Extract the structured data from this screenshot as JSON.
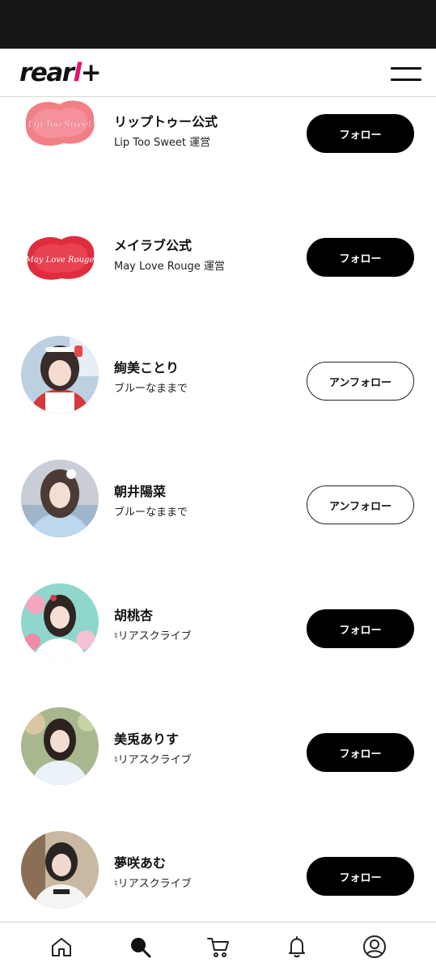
{
  "header": {
    "logo_main": "rear",
    "logo_accent": "l",
    "logo_plus": "+",
    "menu_icon": "hamburger-menu-icon"
  },
  "list": {
    "items": [
      {
        "name": "リップトゥー公式",
        "sub": "Lip Too Sweet 運営",
        "avatar_type": "logo",
        "logo_text": "Lip Too Sweet",
        "button": "フォロー",
        "following": false
      },
      {
        "name": "メイラブ公式",
        "sub": "May Love Rouge 運営",
        "avatar_type": "logo",
        "logo_text": "May Love Rouge",
        "button": "フォロー",
        "following": false
      },
      {
        "name": "絢美ことり",
        "sub": "ブルーなままで",
        "avatar_type": "photo",
        "button": "アンフォロー",
        "following": true
      },
      {
        "name": "朝井陽菜",
        "sub": "ブルーなままで",
        "avatar_type": "photo",
        "button": "アンフォロー",
        "following": true
      },
      {
        "name": "胡桃杏",
        "sub": "♮リアスクライブ",
        "avatar_type": "photo",
        "button": "フォロー",
        "following": false
      },
      {
        "name": "美兎ありす",
        "sub": "♮リアスクライブ",
        "avatar_type": "photo",
        "button": "フォロー",
        "following": false
      },
      {
        "name": "夢咲あむ",
        "sub": "♮リアスクライブ",
        "avatar_type": "photo",
        "button": "フォロー",
        "following": false
      }
    ]
  },
  "bottom_nav": {
    "items": [
      {
        "icon": "home-icon",
        "active": false
      },
      {
        "icon": "search-icon",
        "active": true
      },
      {
        "icon": "cart-icon",
        "active": false
      },
      {
        "icon": "bell-icon",
        "active": false
      },
      {
        "icon": "user-icon",
        "active": false
      }
    ]
  },
  "colors": {
    "accent": "#e3146f",
    "button_bg": "#000000",
    "button_text": "#ffffff",
    "status_bar": "#161414"
  }
}
